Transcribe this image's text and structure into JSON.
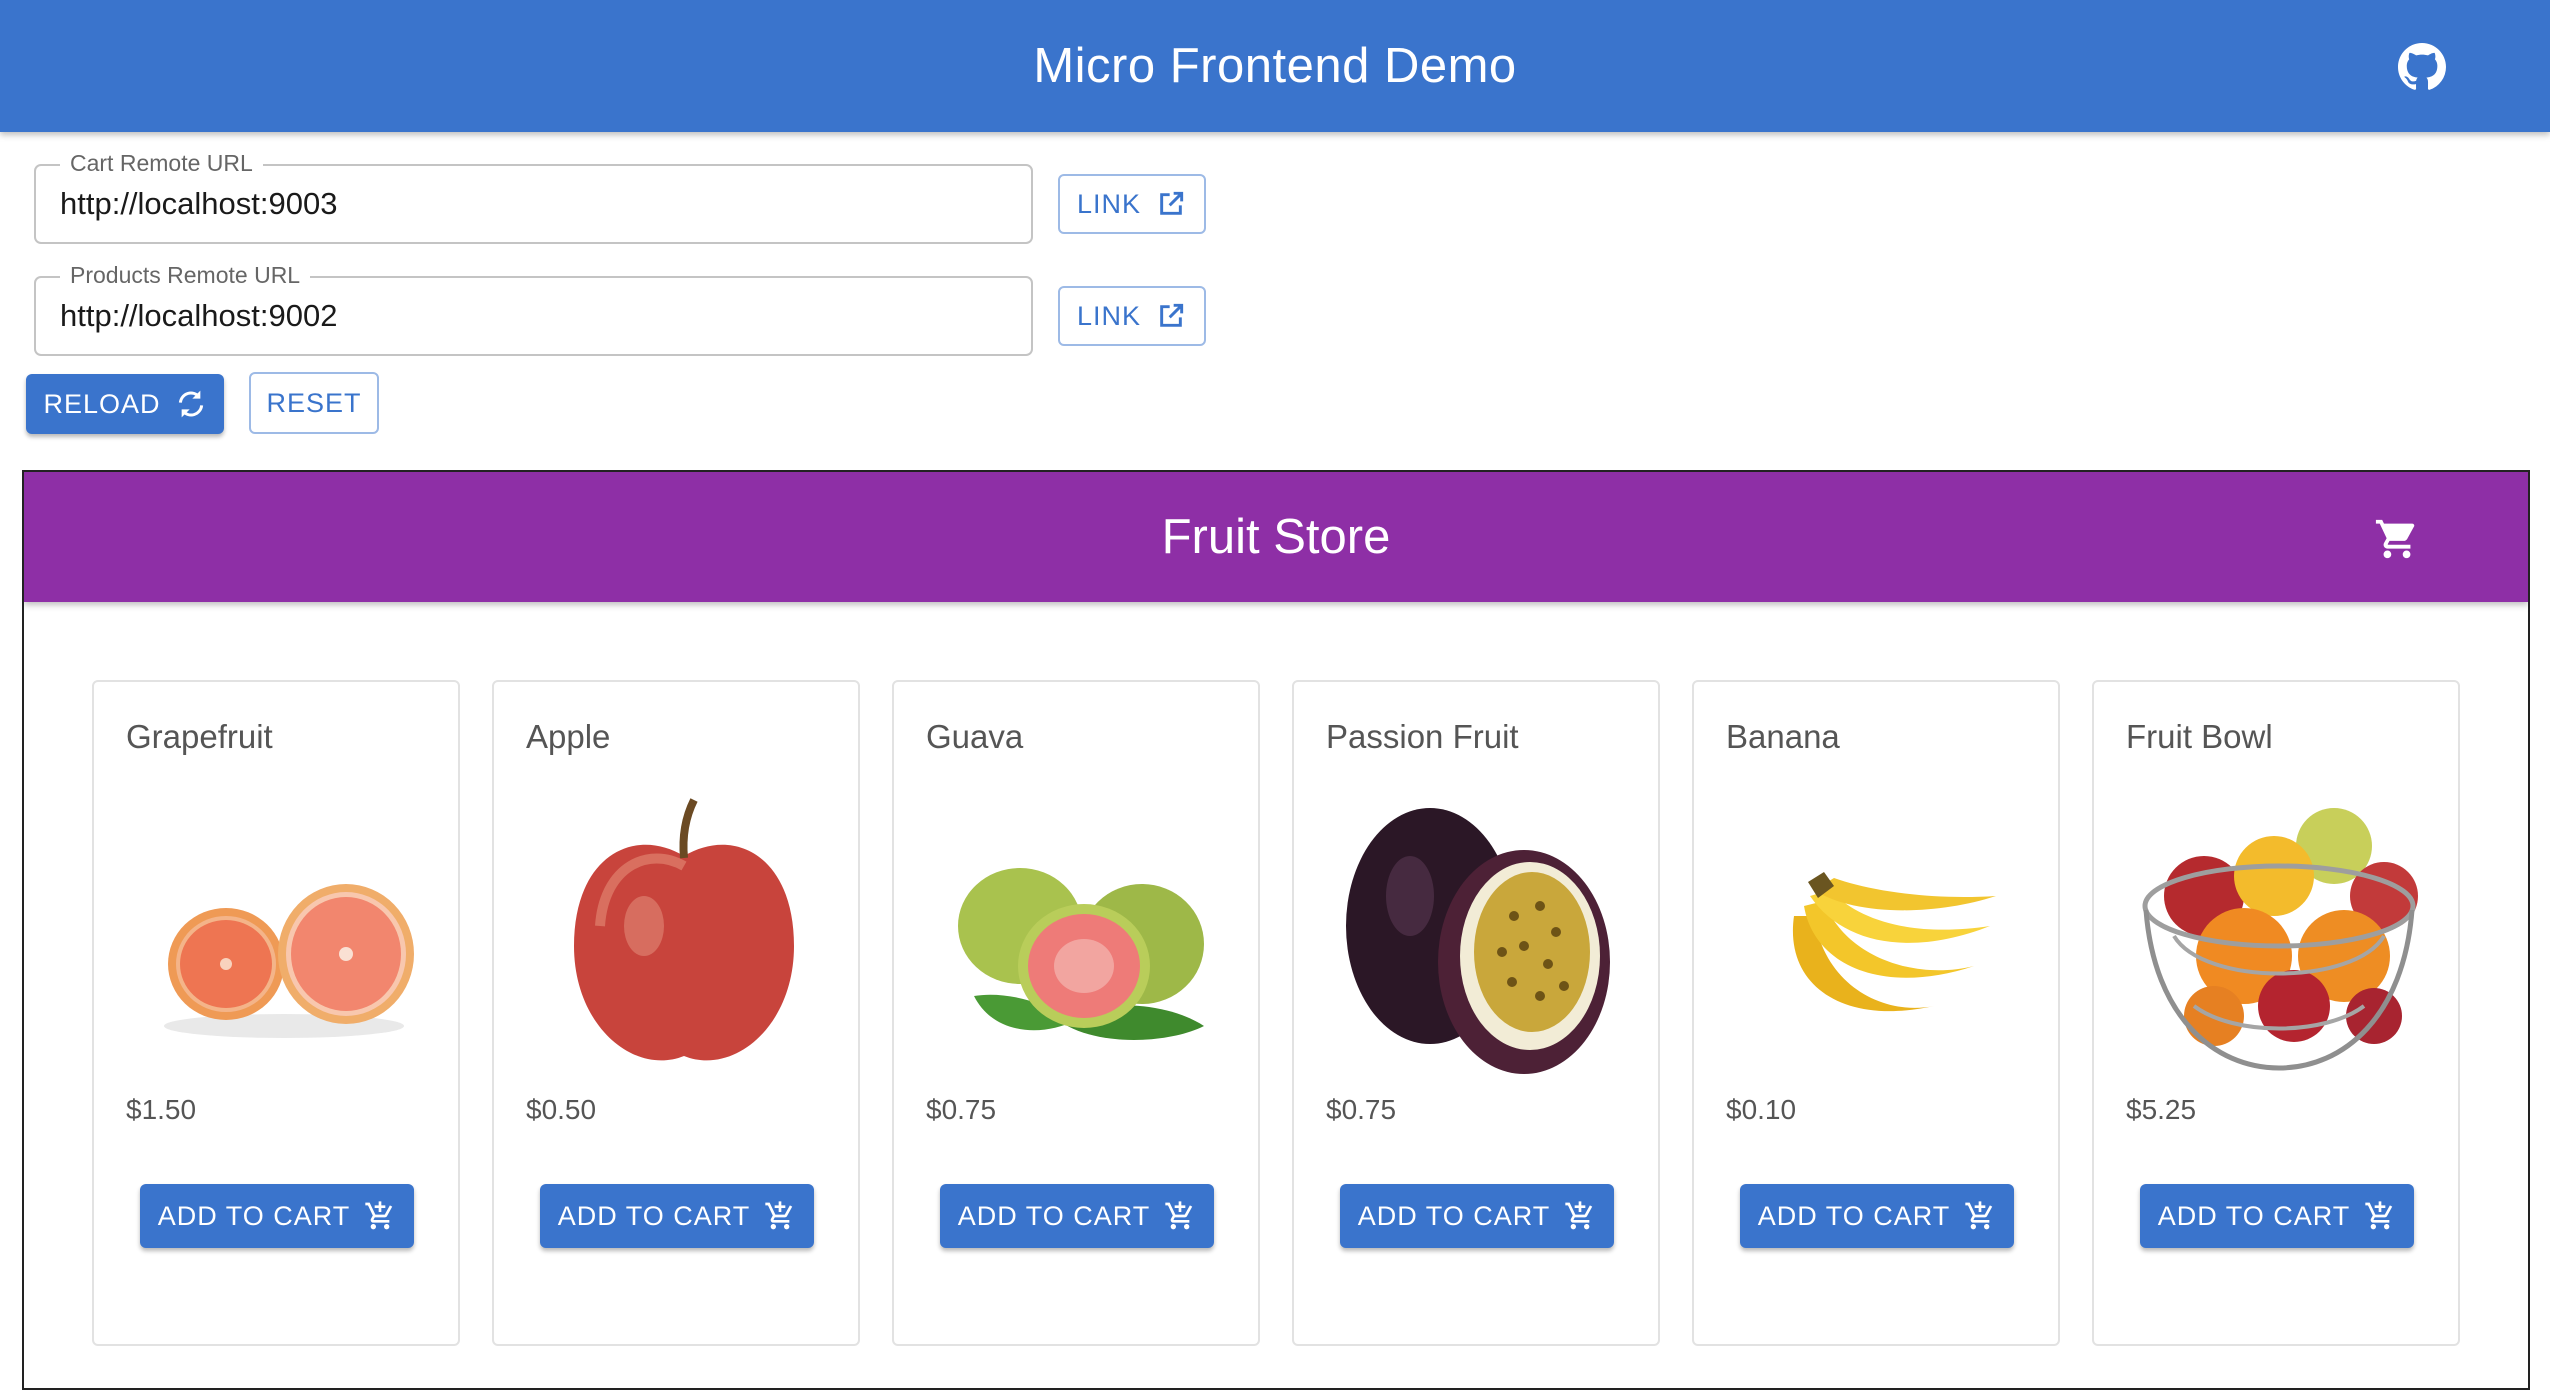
{
  "app_bar": {
    "title": "Micro Frontend Demo",
    "icon": "github-icon",
    "color": "#3a74cc"
  },
  "form": {
    "cart_remote": {
      "label": "Cart Remote URL",
      "value": "http://localhost:9003",
      "link_label": "LINK"
    },
    "products_remote": {
      "label": "Products Remote URL",
      "value": "http://localhost:9002",
      "link_label": "LINK"
    },
    "reload_label": "RELOAD",
    "reset_label": "RESET"
  },
  "store": {
    "title": "Fruit Store",
    "icon": "cart-icon",
    "color": "#8e2fa6",
    "add_to_cart_label": "ADD TO CART",
    "products": [
      {
        "name": "Grapefruit",
        "price": "$1.50"
      },
      {
        "name": "Apple",
        "price": "$0.50"
      },
      {
        "name": "Guava",
        "price": "$0.75"
      },
      {
        "name": "Passion Fruit",
        "price": "$0.75"
      },
      {
        "name": "Banana",
        "price": "$0.10"
      },
      {
        "name": "Fruit Bowl",
        "price": "$5.25"
      }
    ]
  }
}
